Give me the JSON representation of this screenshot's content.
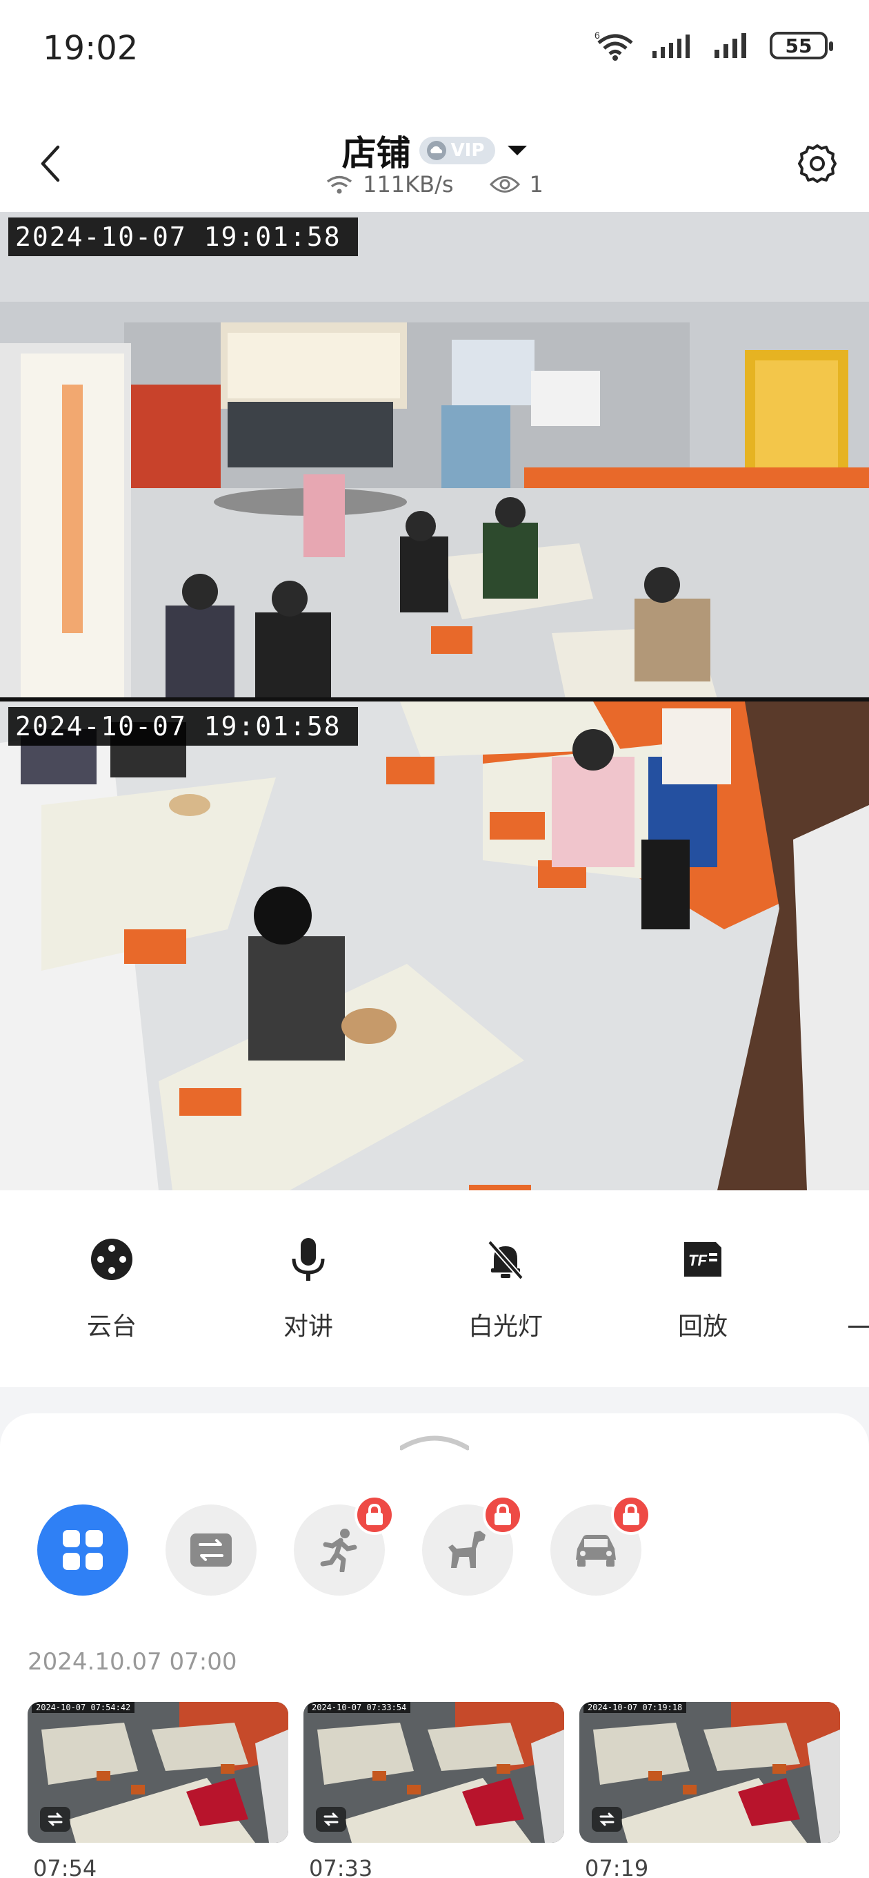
{
  "status_bar": {
    "time": "19:02",
    "network": "6",
    "battery": "55"
  },
  "header": {
    "title": "店铺",
    "vip_label": "VIP",
    "speed": "111KB/s",
    "viewers": "1"
  },
  "feeds": [
    {
      "timestamp": "2024-10-07 19:01:58"
    },
    {
      "timestamp": "2024-10-07 19:01:58"
    }
  ],
  "controls": [
    {
      "label": "云台",
      "icon": "ptz-joystick-icon"
    },
    {
      "label": "对讲",
      "icon": "microphone-icon"
    },
    {
      "label": "白光灯",
      "icon": "light-off-icon"
    },
    {
      "label": "回放",
      "icon": "tf-card-icon"
    }
  ],
  "filters": [
    {
      "name": "all-events",
      "icon": "grid-icon",
      "active": true,
      "locked": false
    },
    {
      "name": "video-switch",
      "icon": "switch-icon",
      "active": false,
      "locked": false
    },
    {
      "name": "person",
      "icon": "running-person-icon",
      "active": false,
      "locked": true
    },
    {
      "name": "pet",
      "icon": "dog-icon",
      "active": false,
      "locked": true
    },
    {
      "name": "vehicle",
      "icon": "car-icon",
      "active": false,
      "locked": true
    }
  ],
  "events": {
    "date_label": "2024.10.07 07:00",
    "items": [
      {
        "time": "07:54",
        "thumb_timestamp": "2024-10-07 07:54:42"
      },
      {
        "time": "07:33",
        "thumb_timestamp": "2024-10-07 07:33:54"
      },
      {
        "time": "07:19",
        "thumb_timestamp": "2024-10-07 07:19:18"
      }
    ]
  },
  "colors": {
    "accent": "#2f80f5",
    "lock": "#ee4a45",
    "orange": "#e8692a"
  }
}
